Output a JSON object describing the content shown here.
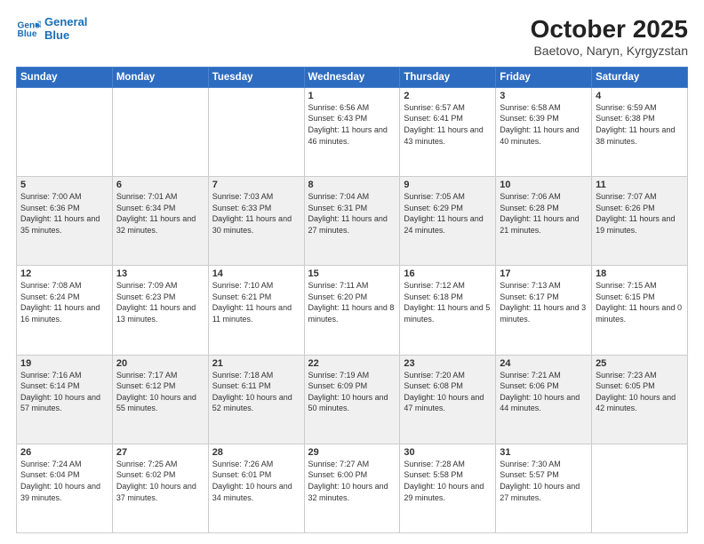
{
  "header": {
    "logo_line1": "General",
    "logo_line2": "Blue",
    "title": "October 2025",
    "subtitle": "Baetovo, Naryn, Kyrgyzstan"
  },
  "days_of_week": [
    "Sunday",
    "Monday",
    "Tuesday",
    "Wednesday",
    "Thursday",
    "Friday",
    "Saturday"
  ],
  "weeks": [
    [
      {
        "num": "",
        "info": ""
      },
      {
        "num": "",
        "info": ""
      },
      {
        "num": "",
        "info": ""
      },
      {
        "num": "1",
        "info": "Sunrise: 6:56 AM\nSunset: 6:43 PM\nDaylight: 11 hours and 46 minutes."
      },
      {
        "num": "2",
        "info": "Sunrise: 6:57 AM\nSunset: 6:41 PM\nDaylight: 11 hours and 43 minutes."
      },
      {
        "num": "3",
        "info": "Sunrise: 6:58 AM\nSunset: 6:39 PM\nDaylight: 11 hours and 40 minutes."
      },
      {
        "num": "4",
        "info": "Sunrise: 6:59 AM\nSunset: 6:38 PM\nDaylight: 11 hours and 38 minutes."
      }
    ],
    [
      {
        "num": "5",
        "info": "Sunrise: 7:00 AM\nSunset: 6:36 PM\nDaylight: 11 hours and 35 minutes."
      },
      {
        "num": "6",
        "info": "Sunrise: 7:01 AM\nSunset: 6:34 PM\nDaylight: 11 hours and 32 minutes."
      },
      {
        "num": "7",
        "info": "Sunrise: 7:03 AM\nSunset: 6:33 PM\nDaylight: 11 hours and 30 minutes."
      },
      {
        "num": "8",
        "info": "Sunrise: 7:04 AM\nSunset: 6:31 PM\nDaylight: 11 hours and 27 minutes."
      },
      {
        "num": "9",
        "info": "Sunrise: 7:05 AM\nSunset: 6:29 PM\nDaylight: 11 hours and 24 minutes."
      },
      {
        "num": "10",
        "info": "Sunrise: 7:06 AM\nSunset: 6:28 PM\nDaylight: 11 hours and 21 minutes."
      },
      {
        "num": "11",
        "info": "Sunrise: 7:07 AM\nSunset: 6:26 PM\nDaylight: 11 hours and 19 minutes."
      }
    ],
    [
      {
        "num": "12",
        "info": "Sunrise: 7:08 AM\nSunset: 6:24 PM\nDaylight: 11 hours and 16 minutes."
      },
      {
        "num": "13",
        "info": "Sunrise: 7:09 AM\nSunset: 6:23 PM\nDaylight: 11 hours and 13 minutes."
      },
      {
        "num": "14",
        "info": "Sunrise: 7:10 AM\nSunset: 6:21 PM\nDaylight: 11 hours and 11 minutes."
      },
      {
        "num": "15",
        "info": "Sunrise: 7:11 AM\nSunset: 6:20 PM\nDaylight: 11 hours and 8 minutes."
      },
      {
        "num": "16",
        "info": "Sunrise: 7:12 AM\nSunset: 6:18 PM\nDaylight: 11 hours and 5 minutes."
      },
      {
        "num": "17",
        "info": "Sunrise: 7:13 AM\nSunset: 6:17 PM\nDaylight: 11 hours and 3 minutes."
      },
      {
        "num": "18",
        "info": "Sunrise: 7:15 AM\nSunset: 6:15 PM\nDaylight: 11 hours and 0 minutes."
      }
    ],
    [
      {
        "num": "19",
        "info": "Sunrise: 7:16 AM\nSunset: 6:14 PM\nDaylight: 10 hours and 57 minutes."
      },
      {
        "num": "20",
        "info": "Sunrise: 7:17 AM\nSunset: 6:12 PM\nDaylight: 10 hours and 55 minutes."
      },
      {
        "num": "21",
        "info": "Sunrise: 7:18 AM\nSunset: 6:11 PM\nDaylight: 10 hours and 52 minutes."
      },
      {
        "num": "22",
        "info": "Sunrise: 7:19 AM\nSunset: 6:09 PM\nDaylight: 10 hours and 50 minutes."
      },
      {
        "num": "23",
        "info": "Sunrise: 7:20 AM\nSunset: 6:08 PM\nDaylight: 10 hours and 47 minutes."
      },
      {
        "num": "24",
        "info": "Sunrise: 7:21 AM\nSunset: 6:06 PM\nDaylight: 10 hours and 44 minutes."
      },
      {
        "num": "25",
        "info": "Sunrise: 7:23 AM\nSunset: 6:05 PM\nDaylight: 10 hours and 42 minutes."
      }
    ],
    [
      {
        "num": "26",
        "info": "Sunrise: 7:24 AM\nSunset: 6:04 PM\nDaylight: 10 hours and 39 minutes."
      },
      {
        "num": "27",
        "info": "Sunrise: 7:25 AM\nSunset: 6:02 PM\nDaylight: 10 hours and 37 minutes."
      },
      {
        "num": "28",
        "info": "Sunrise: 7:26 AM\nSunset: 6:01 PM\nDaylight: 10 hours and 34 minutes."
      },
      {
        "num": "29",
        "info": "Sunrise: 7:27 AM\nSunset: 6:00 PM\nDaylight: 10 hours and 32 minutes."
      },
      {
        "num": "30",
        "info": "Sunrise: 7:28 AM\nSunset: 5:58 PM\nDaylight: 10 hours and 29 minutes."
      },
      {
        "num": "31",
        "info": "Sunrise: 7:30 AM\nSunset: 5:57 PM\nDaylight: 10 hours and 27 minutes."
      },
      {
        "num": "",
        "info": ""
      }
    ]
  ]
}
